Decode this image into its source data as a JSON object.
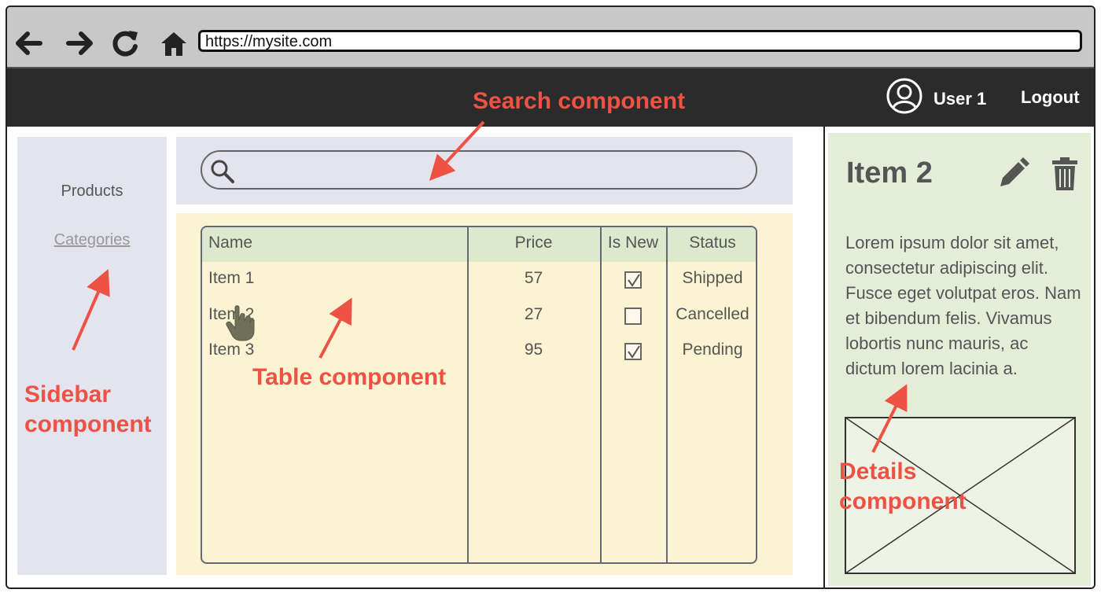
{
  "browser": {
    "url": "https://mysite.com"
  },
  "header": {
    "user_label": "User 1",
    "logout_label": "Logout"
  },
  "sidebar": {
    "items": [
      {
        "label": "Products"
      },
      {
        "label": "Categories"
      }
    ]
  },
  "search": {
    "placeholder": ""
  },
  "table": {
    "columns": [
      "Name",
      "Price",
      "Is New",
      "Status"
    ],
    "rows": [
      {
        "name": "Item 1",
        "price": "57",
        "is_new": true,
        "status": "Shipped"
      },
      {
        "name": "Item 2",
        "price": "27",
        "is_new": false,
        "status": "Cancelled"
      },
      {
        "name": "Item 3",
        "price": "95",
        "is_new": true,
        "status": "Pending"
      }
    ]
  },
  "details": {
    "title": "Item 2",
    "description": "Lorem ipsum dolor sit amet, consectetur adipiscing elit. Fusce eget volutpat eros. Nam et bibendum felis. Vivamus lobortis nunc mauris, ac dictum lorem lacinia a."
  },
  "annotations": {
    "search": "Search component",
    "table": "Table component",
    "sidebar": [
      "Sidebar",
      "component"
    ],
    "details": [
      "Details",
      "component"
    ]
  },
  "colors": {
    "annotation": "#ee5245",
    "appbar": "#2b2b2b",
    "sidebar_bg": "#e4e4ee",
    "table_bg": "#fbf3d2",
    "details_bg": "#e4edd8"
  },
  "icons": [
    "back-arrow-icon",
    "forward-arrow-icon",
    "reload-icon",
    "home-icon",
    "user-avatar-icon",
    "search-icon",
    "pencil-icon",
    "trash-icon",
    "image-placeholder-icon",
    "hand-cursor-icon"
  ]
}
